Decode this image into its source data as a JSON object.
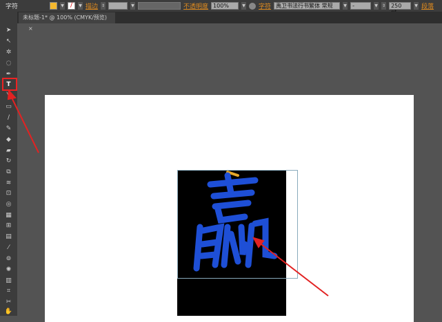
{
  "control_bar": {
    "mode_label": "字符",
    "fill_color": "#f5b82e",
    "stroke_label": "描边",
    "opacity_label": "不透明度",
    "opacity_value": "100%",
    "char_label": "字符",
    "font_family": "禹卫书法行书繁体",
    "font_style": "常规",
    "font_sub": "-",
    "font_size": "250 pt",
    "para_label": "段落"
  },
  "document_tab": {
    "title": "未标题-1* @ 100% (CMYK/预览)",
    "close": "×"
  },
  "canvas": {
    "text_fill": "#1e4fd6",
    "annotation_color": "#e22222"
  }
}
